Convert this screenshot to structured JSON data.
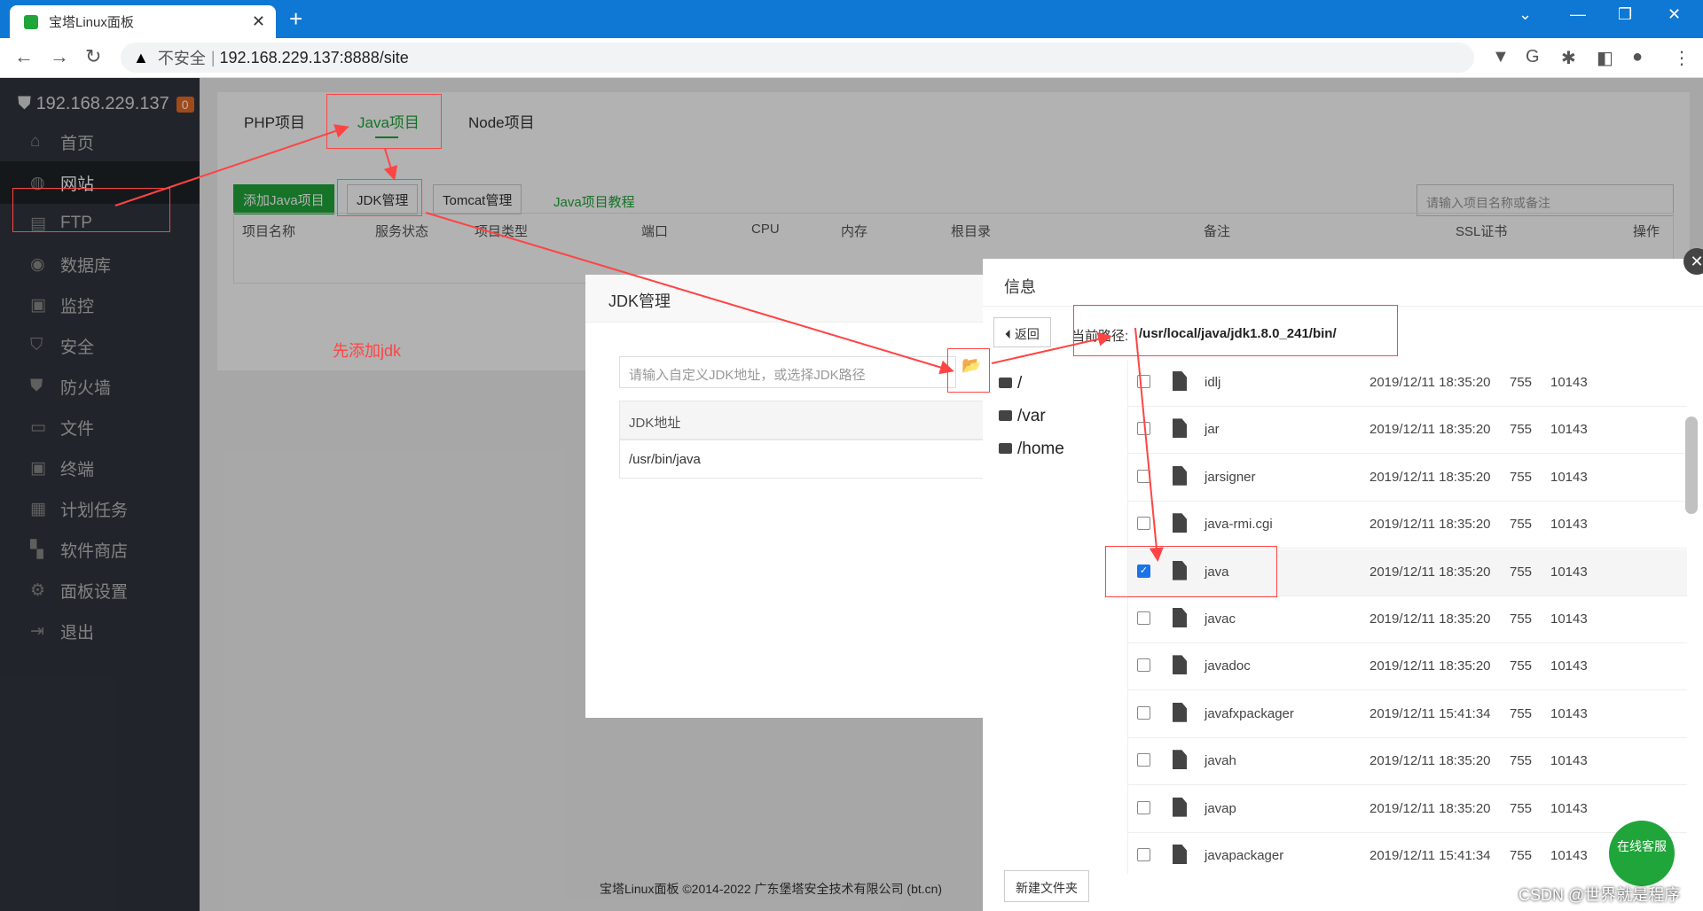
{
  "browser": {
    "tab_title": "宝塔Linux面板",
    "insecure": "不安全",
    "url": "192.168.229.137:8888/site"
  },
  "sidebar": {
    "host": "192.168.229.137",
    "badge": "0",
    "items": [
      {
        "label": "首页"
      },
      {
        "label": "网站"
      },
      {
        "label": "FTP"
      },
      {
        "label": "数据库"
      },
      {
        "label": "监控"
      },
      {
        "label": "安全"
      },
      {
        "label": "防火墙"
      },
      {
        "label": "文件"
      },
      {
        "label": "终端"
      },
      {
        "label": "计划任务"
      },
      {
        "label": "软件商店"
      },
      {
        "label": "面板设置"
      },
      {
        "label": "退出"
      }
    ]
  },
  "project_tabs": [
    "PHP项目",
    "Java项目",
    "Node项目"
  ],
  "toolbar": {
    "add": "添加Java项目",
    "jdk": "JDK管理",
    "tomcat": "Tomcat管理",
    "tutorial": "Java项目教程",
    "search_placeholder": "请输入项目名称或备注"
  },
  "table_headers": [
    "项目名称",
    "服务状态",
    "项目类型",
    "端口",
    "CPU",
    "内存",
    "根目录",
    "备注",
    "SSL证书",
    "操作"
  ],
  "annotation": "先添加jdk",
  "jdk_dialog": {
    "title": "JDK管理",
    "input_placeholder": "请输入自定义JDK地址，或选择JDK路径",
    "col": "JDK地址",
    "row": "/usr/bin/java"
  },
  "file_dialog": {
    "title": "信息",
    "back": "返回",
    "current_label": "当前路径:",
    "current_path": "/usr/local/java/jdk1.8.0_241/bin/",
    "dirs": [
      "/",
      "/var",
      "/home"
    ],
    "new_folder": "新建文件夹",
    "files": [
      {
        "name": "idlj",
        "date": "2019/12/11 18:35:20",
        "perm": "755",
        "owner": "10143",
        "checked": false
      },
      {
        "name": "jar",
        "date": "2019/12/11 18:35:20",
        "perm": "755",
        "owner": "10143",
        "checked": false
      },
      {
        "name": "jarsigner",
        "date": "2019/12/11 18:35:20",
        "perm": "755",
        "owner": "10143",
        "checked": false
      },
      {
        "name": "java-rmi.cgi",
        "date": "2019/12/11 18:35:20",
        "perm": "755",
        "owner": "10143",
        "checked": false
      },
      {
        "name": "java",
        "date": "2019/12/11 18:35:20",
        "perm": "755",
        "owner": "10143",
        "checked": true
      },
      {
        "name": "javac",
        "date": "2019/12/11 18:35:20",
        "perm": "755",
        "owner": "10143",
        "checked": false
      },
      {
        "name": "javadoc",
        "date": "2019/12/11 18:35:20",
        "perm": "755",
        "owner": "10143",
        "checked": false
      },
      {
        "name": "javafxpackager",
        "date": "2019/12/11 15:41:34",
        "perm": "755",
        "owner": "10143",
        "checked": false
      },
      {
        "name": "javah",
        "date": "2019/12/11 18:35:20",
        "perm": "755",
        "owner": "10143",
        "checked": false
      },
      {
        "name": "javap",
        "date": "2019/12/11 18:35:20",
        "perm": "755",
        "owner": "10143",
        "checked": false
      },
      {
        "name": "javapackager",
        "date": "2019/12/11 15:41:34",
        "perm": "755",
        "owner": "10143",
        "checked": false
      }
    ]
  },
  "footer": "宝塔Linux面板 ©2014-2022 广东堡塔安全技术有限公司 (bt.cn)",
  "chat": "在线客服",
  "watermark": "CSDN @世界就是程序"
}
